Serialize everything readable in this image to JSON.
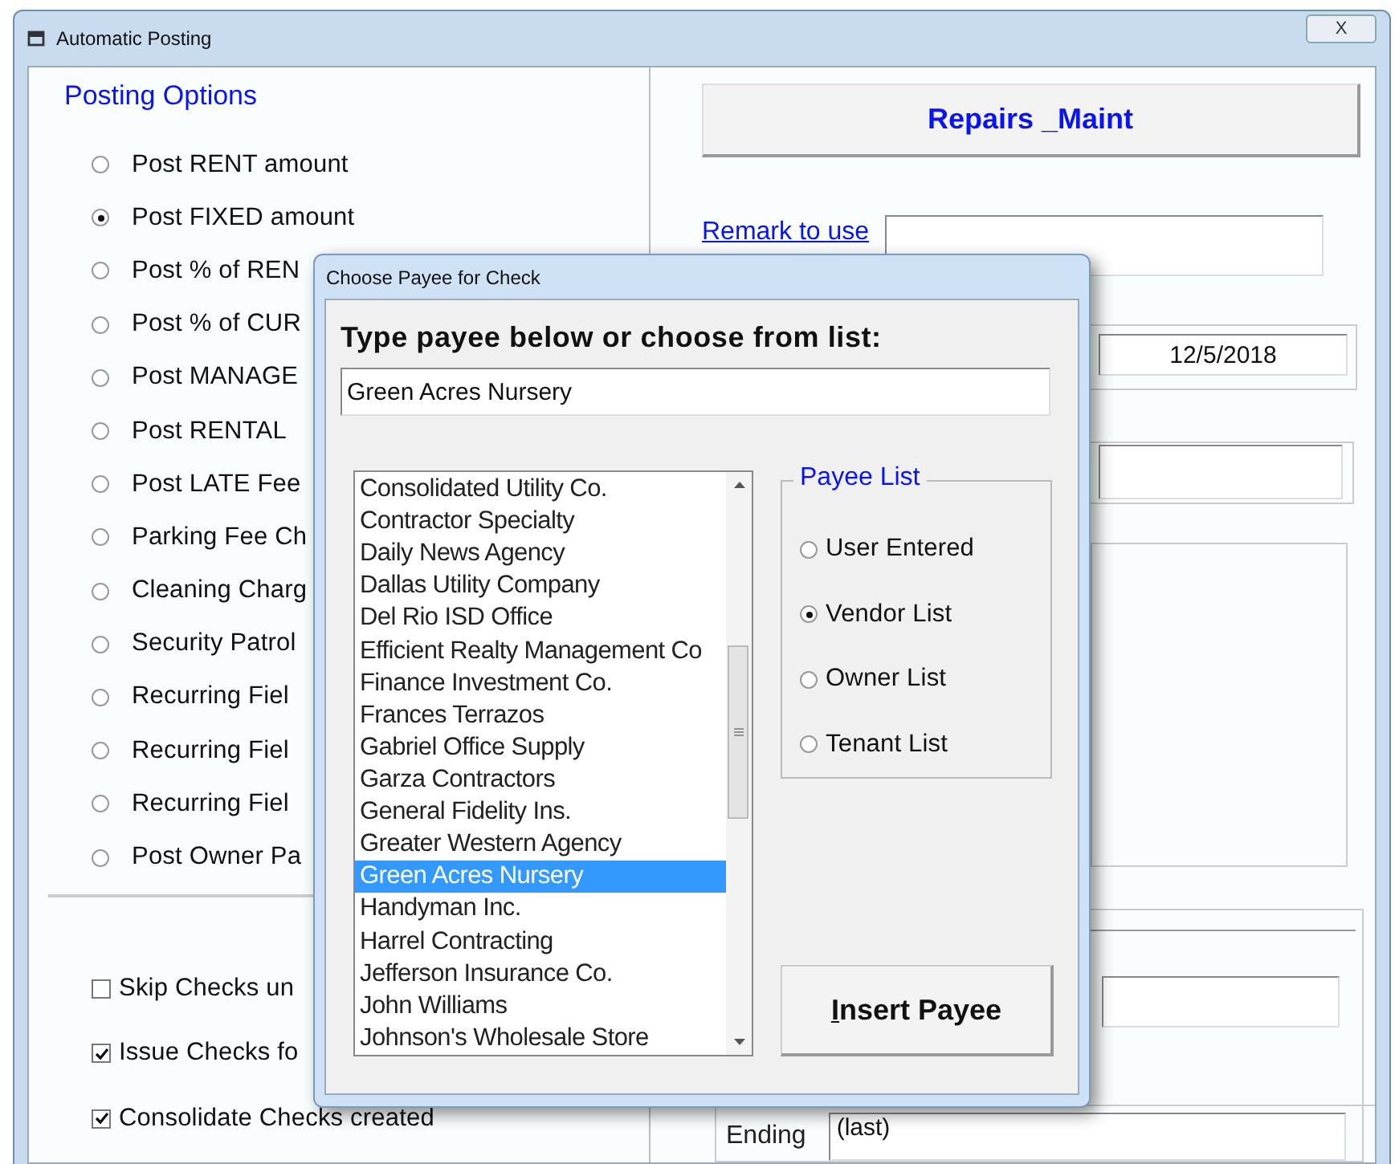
{
  "window": {
    "title": "Automatic Posting",
    "close": "X"
  },
  "posting_options": {
    "title": "Posting Options",
    "options": [
      {
        "label": "Post RENT amount",
        "selected": false
      },
      {
        "label": "Post FIXED amount",
        "selected": true
      },
      {
        "label": "Post % of REN",
        "selected": false
      },
      {
        "label": "Post % of CUR",
        "selected": false
      },
      {
        "label": "Post MANAGE",
        "selected": false
      },
      {
        "label": "Post RENTAL",
        "selected": false
      },
      {
        "label": "Post LATE Fee",
        "selected": false
      },
      {
        "label": "Parking Fee Ch",
        "selected": false
      },
      {
        "label": "Cleaning Charg",
        "selected": false
      },
      {
        "label": "Security Patrol",
        "selected": false
      },
      {
        "label": "Recurring Fiel",
        "selected": false
      },
      {
        "label": "Recurring Fiel",
        "selected": false
      },
      {
        "label": "Recurring Fiel",
        "selected": false
      },
      {
        "label": "Post Owner Pa",
        "selected": false
      }
    ]
  },
  "check_options": [
    {
      "label": "Skip Checks un",
      "checked": false
    },
    {
      "label": "Issue Checks fo",
      "checked": true
    },
    {
      "label": "Consolidate Checks created",
      "checked": true
    }
  ],
  "account_button": "Repairs _Maint",
  "remark": {
    "label": "Remark to use"
  },
  "date_field": {
    "value": "12/5/2018"
  },
  "ending": {
    "label": "Ending",
    "value": "(last)"
  },
  "dialog": {
    "title": "Choose Payee for Check",
    "heading": "Type payee below or choose from list:",
    "payee_field": {
      "value": "Green Acres Nursery"
    },
    "payees": [
      {
        "name": "Consolidated Utility Co.",
        "selected": false
      },
      {
        "name": "Contractor Specialty",
        "selected": false
      },
      {
        "name": "Daily News Agency",
        "selected": false
      },
      {
        "name": "Dallas Utility Company",
        "selected": false
      },
      {
        "name": "Del Rio ISD Office",
        "selected": false
      },
      {
        "name": "Efficient Realty Management Co",
        "selected": false
      },
      {
        "name": "Finance Investment Co.",
        "selected": false
      },
      {
        "name": "Frances Terrazos",
        "selected": false
      },
      {
        "name": "Gabriel Office Supply",
        "selected": false
      },
      {
        "name": "Garza Contractors",
        "selected": false
      },
      {
        "name": "General Fidelity Ins.",
        "selected": false
      },
      {
        "name": "Greater Western Agency",
        "selected": false
      },
      {
        "name": "Green Acres Nursery",
        "selected": true
      },
      {
        "name": "Handyman Inc.",
        "selected": false
      },
      {
        "name": "Harrel Contracting",
        "selected": false
      },
      {
        "name": "Jefferson Insurance Co.",
        "selected": false
      },
      {
        "name": "John Williams",
        "selected": false
      },
      {
        "name": "Johnson's Wholesale Store",
        "selected": false
      }
    ],
    "payee_list": {
      "title": "Payee List",
      "options": [
        {
          "label": "User Entered",
          "selected": false
        },
        {
          "label": "Vendor List",
          "selected": true
        },
        {
          "label": "Owner List",
          "selected": false
        },
        {
          "label": "Tenant List",
          "selected": false
        }
      ]
    },
    "insert_button": {
      "label": "Insert Payee",
      "mnemonic": true
    }
  }
}
